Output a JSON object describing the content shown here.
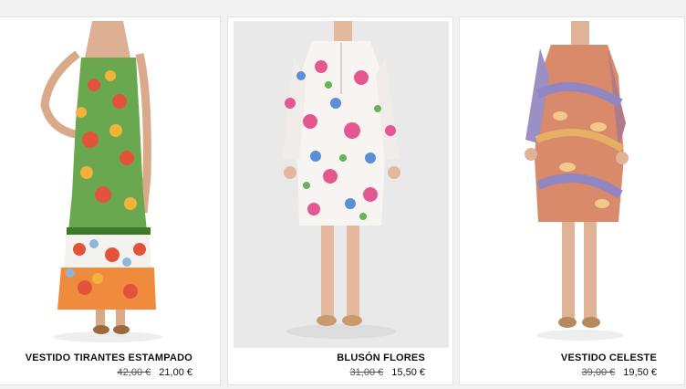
{
  "products": [
    {
      "name": "VESTIDO TIRANTES ESTAMPADO",
      "old_price": "42,00 €",
      "price": "21,00 €",
      "image": "green-floral-maxi-dress-photo"
    },
    {
      "name": "BLUSÓN FLORES",
      "old_price": "31,00 €",
      "price": "15,50 €",
      "image": "white-floral-blouse-dress-photo"
    },
    {
      "name": "VESTIDO CELESTE",
      "old_price": "39,00 €",
      "price": "19,50 €",
      "image": "paisley-dress-photo"
    }
  ],
  "colors": {
    "page_bg": "#f2f2f2",
    "card_bg": "#ffffff",
    "text": "#111111",
    "old_price": "#555555"
  }
}
